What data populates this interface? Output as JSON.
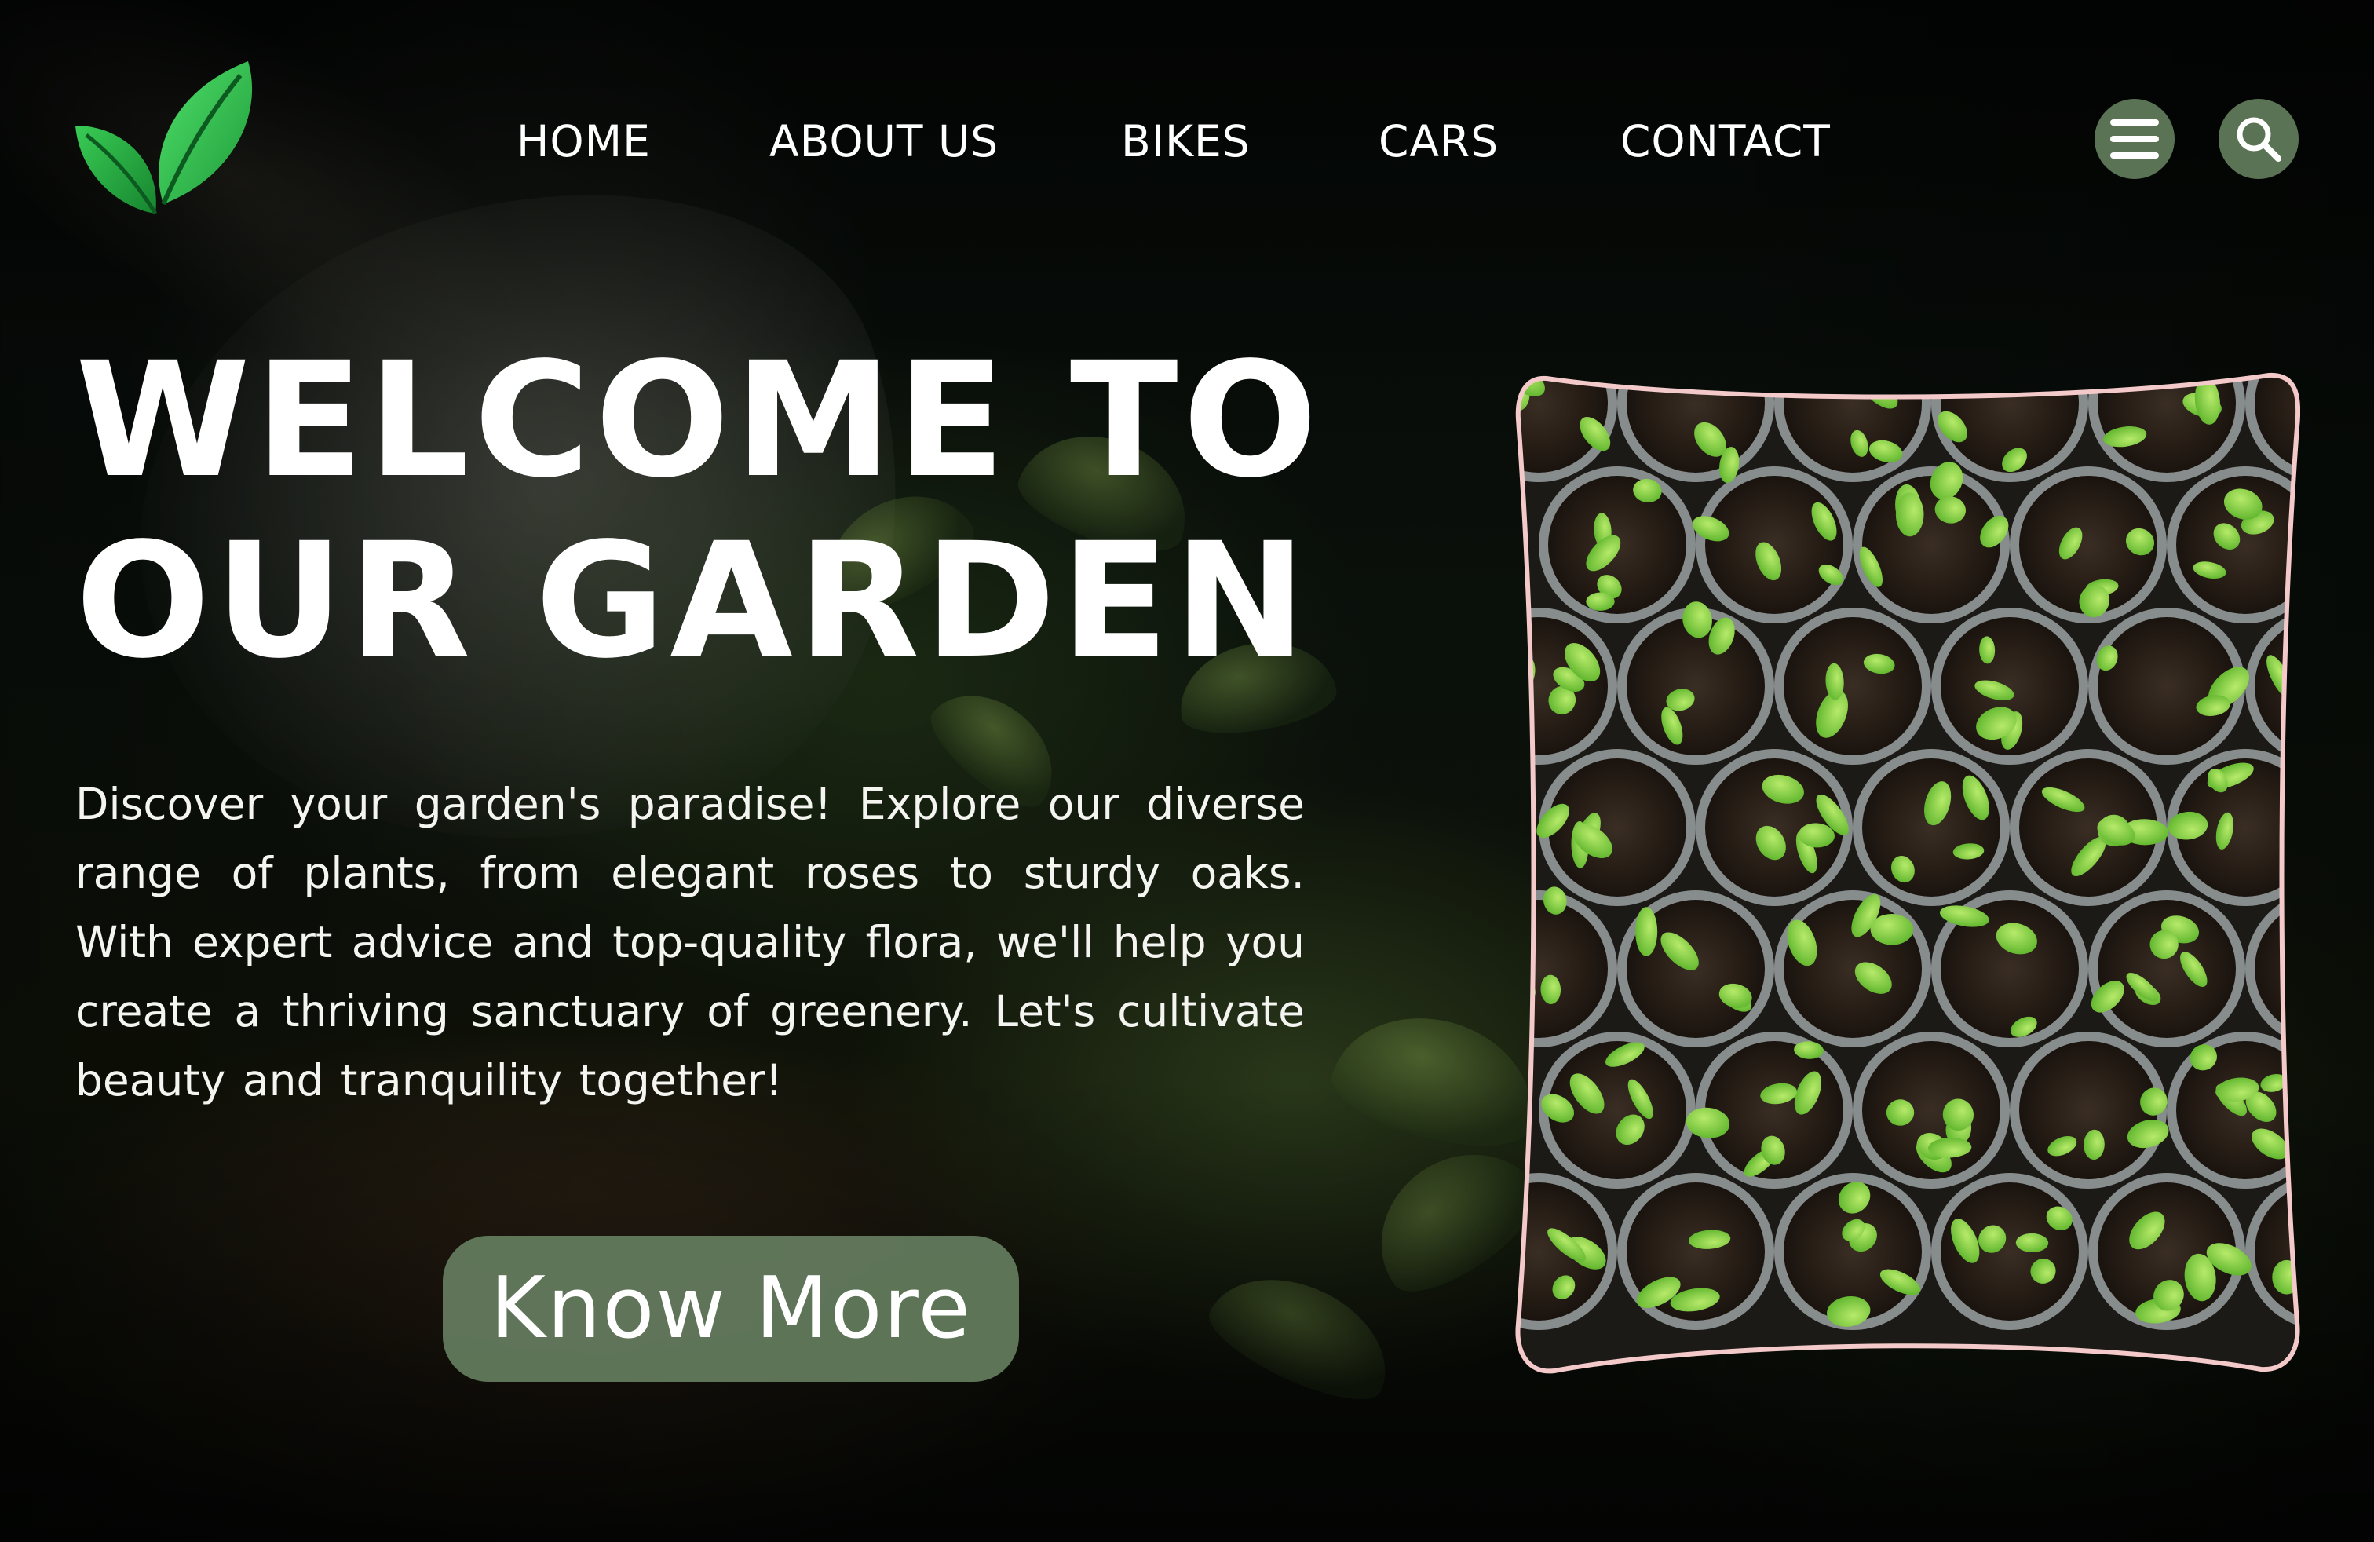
{
  "nav": {
    "items": [
      {
        "label": "HOME"
      },
      {
        "label": "ABOUT US"
      },
      {
        "label": "BIKES"
      },
      {
        "label": "CARS"
      },
      {
        "label": "CONTACT"
      }
    ]
  },
  "header": {
    "logo_icon": "leaf-logo-icon",
    "menu_icon": "hamburger-menu-icon",
    "search_icon": "search-icon",
    "button_color": "#5b7355"
  },
  "hero": {
    "title_line1": "WELCOME TO",
    "title_line2": "OUR GARDEN",
    "description": "Discover your garden's paradise! Explore our diverse range of plants, from elegant roses to sturdy oaks. With expert advice and top-quality flora, we'll help you create a thriving sanctuary of greenery. Let's cultivate beauty and tranquility together!",
    "cta_label": "Know More",
    "cta_color": "#677f61"
  },
  "colors": {
    "accent_green": "#33c24f",
    "frame_border": "#f3c9c9"
  }
}
